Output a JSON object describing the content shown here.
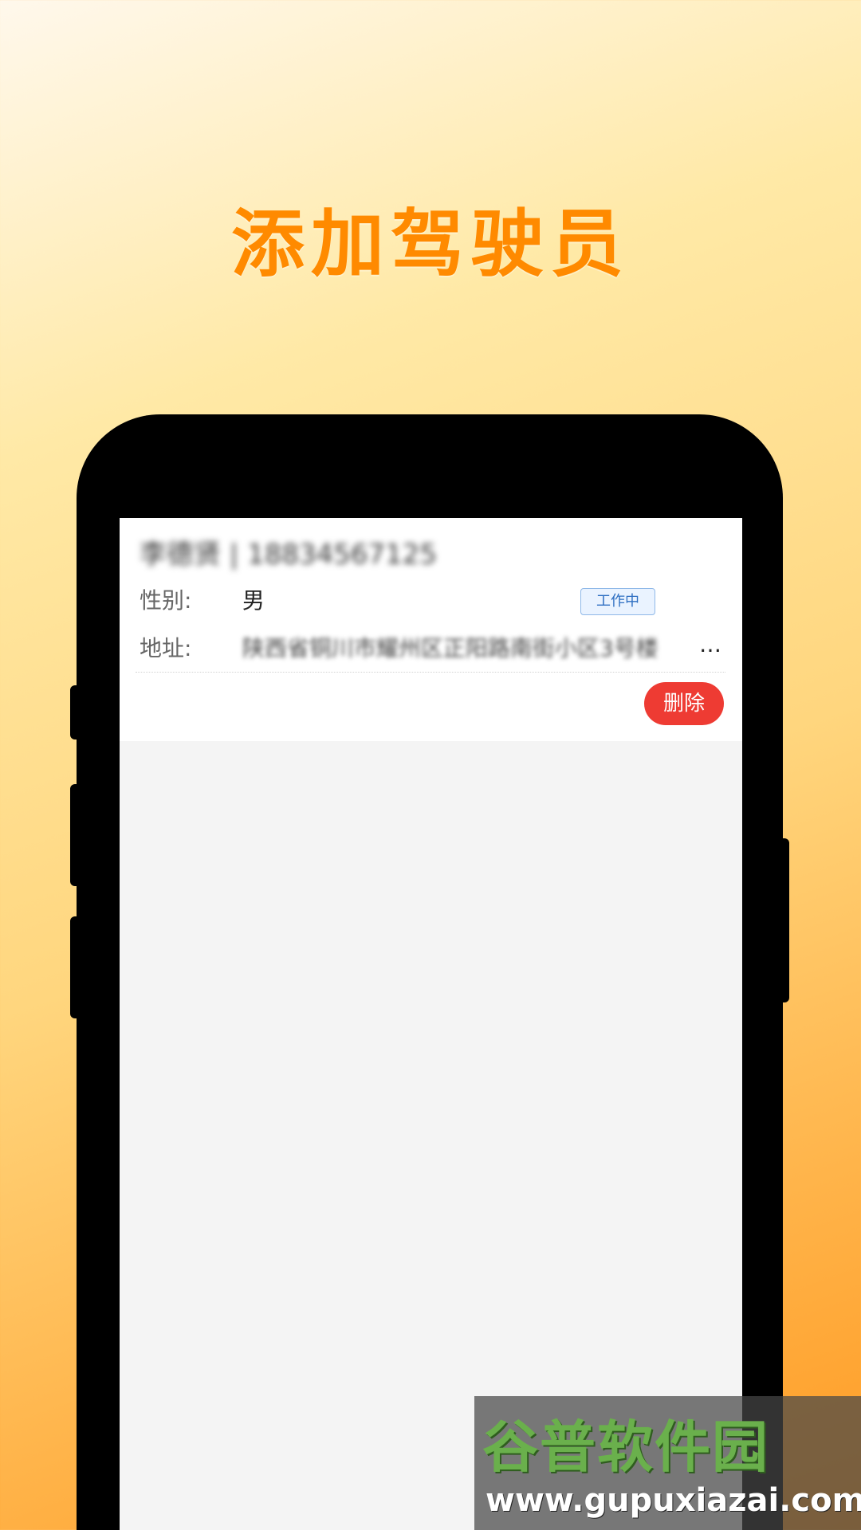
{
  "promo": {
    "title": "添加驾驶员"
  },
  "driver_card": {
    "title": "李德贤 | 18834567125",
    "gender_label": "性别:",
    "gender_value": "男",
    "status_badge": "工作中",
    "address_label": "地址:",
    "address_value": "陕西省铜川市耀州区正阳路南街小区3号楼",
    "address_overflow": "…",
    "delete_label": "删除"
  },
  "watermark": {
    "logo_text": "谷普软件园",
    "url": "www.gupuxiazai.com"
  },
  "colors": {
    "title": "#ff8a00",
    "delete_button": "#ee3b33",
    "badge_border": "#8fb8e8",
    "badge_text": "#2e6fc2"
  }
}
